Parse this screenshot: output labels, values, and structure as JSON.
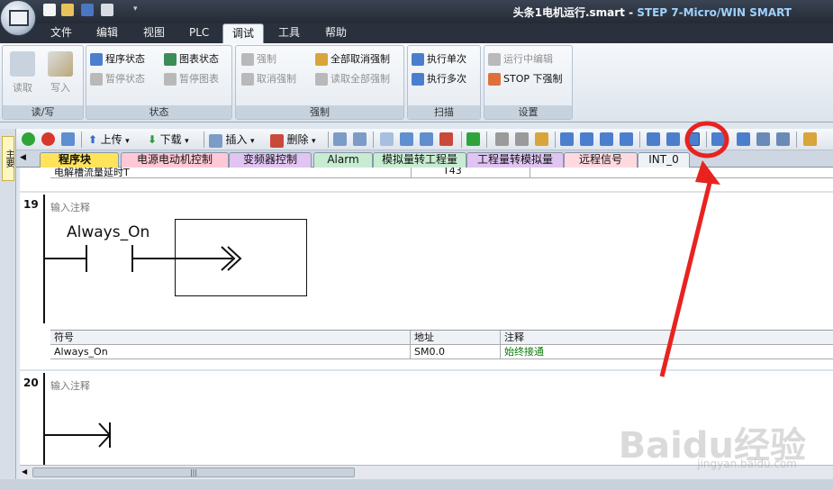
{
  "window": {
    "title_file": "头条1电机运行.smart",
    "title_sep": " - ",
    "title_app": "STEP 7-Micro/WIN SMART"
  },
  "ribbon_tabs": [
    "文件",
    "编辑",
    "视图",
    "PLC",
    "调试",
    "工具",
    "帮助"
  ],
  "active_ribbon_tab": "调试",
  "ribbon": {
    "readwrite": {
      "label": "读/写",
      "read": "读取",
      "write": "写入"
    },
    "status": {
      "label": "状态",
      "program_status": "程序状态",
      "pause_status": "暂停状态",
      "chart_status": "图表状态",
      "pause_chart": "暂停图表"
    },
    "force": {
      "label": "强制",
      "force": "强制",
      "unforce": "取消强制",
      "unforce_all": "全部取消强制",
      "read_all_forced": "读取全部强制"
    },
    "scan": {
      "label": "扫描",
      "single": "执行单次",
      "multiple": "执行多次"
    },
    "settings": {
      "label": "设置",
      "runtime_edit": "运行中编辑",
      "stop_force": "STOP 下强制"
    }
  },
  "toolbar": {
    "upload": "上传",
    "download": "下载",
    "insert": "插入",
    "delete": "删除"
  },
  "left_strip_label": "主要",
  "doc_tabs": [
    "程序块",
    "电源电动机控制",
    "变频器控制",
    "Alarm",
    "模拟量转工程量",
    "工程量转模拟量",
    "远程信号",
    "INT_0"
  ],
  "active_doc_tab": "程序块",
  "tab_close_glyph": "×",
  "editor": {
    "prev_row": {
      "symbol": "电解槽流量延时T",
      "address": "T43"
    },
    "networks": [
      {
        "number": "19",
        "comment": "输入注释",
        "contact_label": "Always_On",
        "symbol_headers": [
          "符号",
          "地址",
          "注释"
        ],
        "symbol_rows": [
          {
            "symbol": "Always_On",
            "address": "SM0.0",
            "comment": "始终接通"
          }
        ]
      },
      {
        "number": "20",
        "comment": "输入注释"
      }
    ]
  },
  "scrollbar_grip": "|||",
  "watermark": {
    "main": "Baidu经验",
    "sub": "jingyan.baidu.com"
  },
  "colors": {
    "annotation": "#e8231f",
    "ribbon_dark": "#2a313c",
    "title_app": "#9fd2ff",
    "comment_green": "#0a7a0a"
  }
}
